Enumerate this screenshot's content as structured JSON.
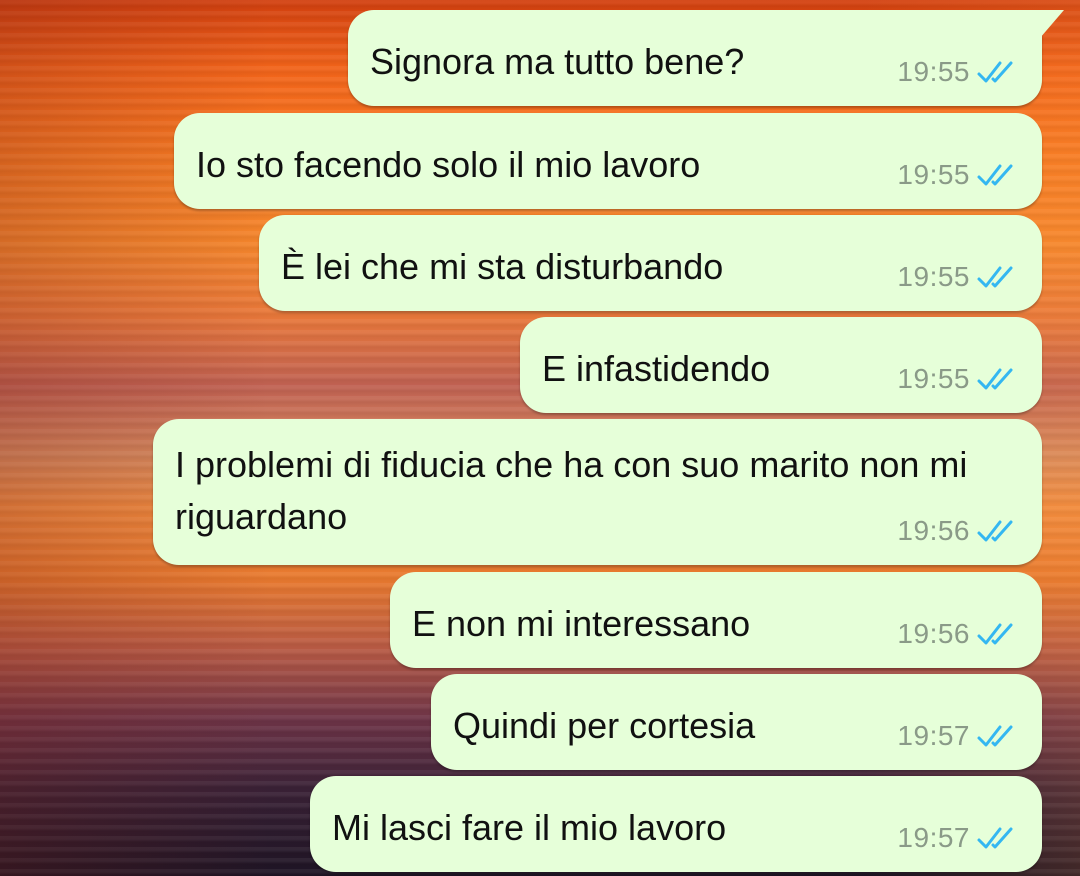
{
  "chat": {
    "messages": [
      {
        "text": "Signora ma tutto bene?",
        "time": "19:55",
        "status": "read"
      },
      {
        "text": "Io sto facendo solo il mio lavoro",
        "time": "19:55",
        "status": "read"
      },
      {
        "text": "È lei che mi sta disturbando",
        "time": "19:55",
        "status": "read"
      },
      {
        "text": "E infastidendo",
        "time": "19:55",
        "status": "read"
      },
      {
        "text": "I problemi di fiducia che ha con suo marito non mi riguardano",
        "time": "19:56",
        "status": "read"
      },
      {
        "text": "E non mi interessano",
        "time": "19:56",
        "status": "read"
      },
      {
        "text": "Quindi per cortesia",
        "time": "19:57",
        "status": "read"
      },
      {
        "text": "Mi lasci fare il mio lavoro",
        "time": "19:57",
        "status": "read"
      }
    ],
    "icons": {
      "read_receipt": "double-check-icon"
    },
    "colors": {
      "bubble": "#e6ffd9",
      "time": "#8a9a88",
      "read_ticks": "#34b7f1"
    }
  }
}
